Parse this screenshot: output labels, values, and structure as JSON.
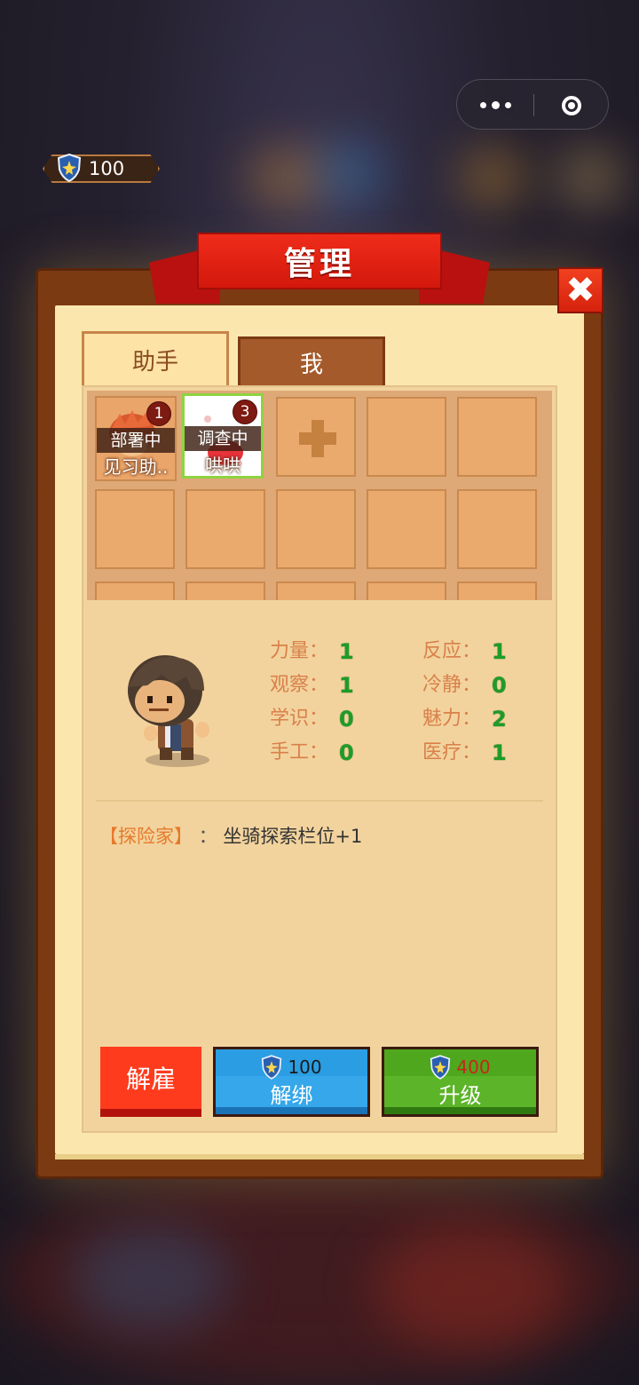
{
  "capsule": {
    "more_icon": "more-dots-icon",
    "close_icon": "target-close-icon"
  },
  "currency": {
    "value": "100",
    "icon": "shield-star-icon"
  },
  "panel": {
    "title": "管理",
    "close_symbol": "✖"
  },
  "tabs": [
    {
      "label": "助手",
      "active": true
    },
    {
      "label": "我",
      "active": false
    }
  ],
  "slots": [
    {
      "badge": "1",
      "status": "部署中",
      "name": "见习助.."
    },
    {
      "badge": "3",
      "status": "调查中",
      "name": "哄哄"
    }
  ],
  "stats": [
    {
      "label": "力量：",
      "value": "1"
    },
    {
      "label": "反应：",
      "value": "1"
    },
    {
      "label": "观察：",
      "value": "1"
    },
    {
      "label": "冷静：",
      "value": "0"
    },
    {
      "label": "学识：",
      "value": "0"
    },
    {
      "label": "魅力：",
      "value": "2"
    },
    {
      "label": "手工：",
      "value": "0"
    },
    {
      "label": "医疗：",
      "value": "1"
    }
  ],
  "trait": {
    "tag": "【探险家】",
    "separator": "：",
    "desc": "坐骑探索栏位+1"
  },
  "buttons": {
    "fire": {
      "label": "解雇"
    },
    "unbind": {
      "cost": "100",
      "label": "解绑"
    },
    "upgrade": {
      "cost": "400",
      "label": "升级"
    }
  }
}
